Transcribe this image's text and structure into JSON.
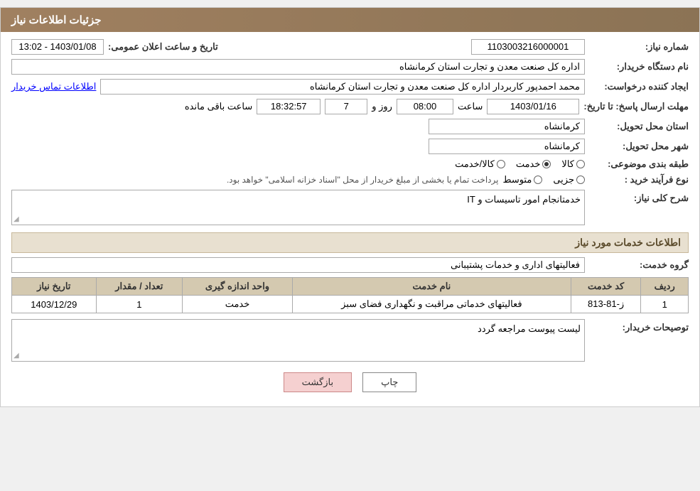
{
  "header": {
    "title": "جزئیات اطلاعات نیاز"
  },
  "fields": {
    "shomareNiaz_label": "شماره نیاز:",
    "shomareNiaz_value": "1103003216000001",
    "namDasgah_label": "نام دستگاه خریدار:",
    "namDasgah_value": "اداره کل صنعت  معدن و تجارت استان کرمانشاه",
    "ejadKonande_label": "ایجاد کننده درخواست:",
    "ejadKonande_value": "محمد احمدپور کاربردار اداره کل صنعت  معدن و تجارت استان کرمانشاه",
    "ejadKonande_link": "اطلاعات تماس خریدار",
    "mohlat_label": "مهلت ارسال پاسخ: تا تاریخ:",
    "mohlat_date": "1403/01/16",
    "mohlat_saatLabel": "ساعت",
    "mohlat_time": "08:00",
    "mohlat_rozLabel": "روز و",
    "mohlat_roz": "7",
    "mohlat_baghimande": "18:32:57",
    "mohlat_baghimande_label": "ساعت باقی مانده",
    "ostan_label": "استان محل تحویل:",
    "ostan_value": "کرمانشاه",
    "shahr_label": "شهر محل تحویل:",
    "shahr_value": "کرمانشاه",
    "tabaqe_label": "طبقه بندی موضوعی:",
    "tabaqe_kala": "کالا",
    "tabaqe_khadamat": "خدمت",
    "tabaqe_kala_khadamat": "کالا/خدمت",
    "tabaqe_selected": "khadamat",
    "noeFarayand_label": "نوع فرآیند خرید :",
    "noeFarayand_jozi": "جزیی",
    "noeFarayand_mota": "متوسط",
    "noeFarayand_text": "پرداخت تمام یا بخشی از مبلغ خریدار از محل \"اسناد خزانه اسلامی\" خواهد بود.",
    "sharh_label": "شرح کلی نیاز:",
    "sharh_value": "خدمتانجام امور تاسیسات و IT",
    "khadamat_title": "اطلاعات خدمات مورد نیاز",
    "grohKhadamat_label": "گروه خدمت:",
    "grohKhadamat_value": "فعالیتهای اداری و خدمات پشتیبانی",
    "table_headers": {
      "radif": "ردیف",
      "kodKhadamat": "کد خدمت",
      "namKhadamat": "نام خدمت",
      "vahedAndaze": "واحد اندازه گیری",
      "tedad": "تعداد / مقدار",
      "tarikNiaz": "تاریخ نیاز"
    },
    "table_rows": [
      {
        "radif": "1",
        "kodKhadamat": "ز-81-813",
        "namKhadamat": "فعالیتهای خدماتی مراقبت و نگهداری فضای سبز",
        "vahedAndaze": "خدمت",
        "tedad": "1",
        "tarikNiaz": "1403/12/29"
      }
    ],
    "tozihat_label": "توصیحات خریدار:",
    "tozihat_value": "لیست پیوست مراجعه گردد",
    "btn_print": "چاپ",
    "btn_back": "بازگشت",
    "tarikAlan_label": "تاریخ و ساعت اعلان عمومی:",
    "tarikAlan_value": "1403/01/08 - 13:02"
  }
}
